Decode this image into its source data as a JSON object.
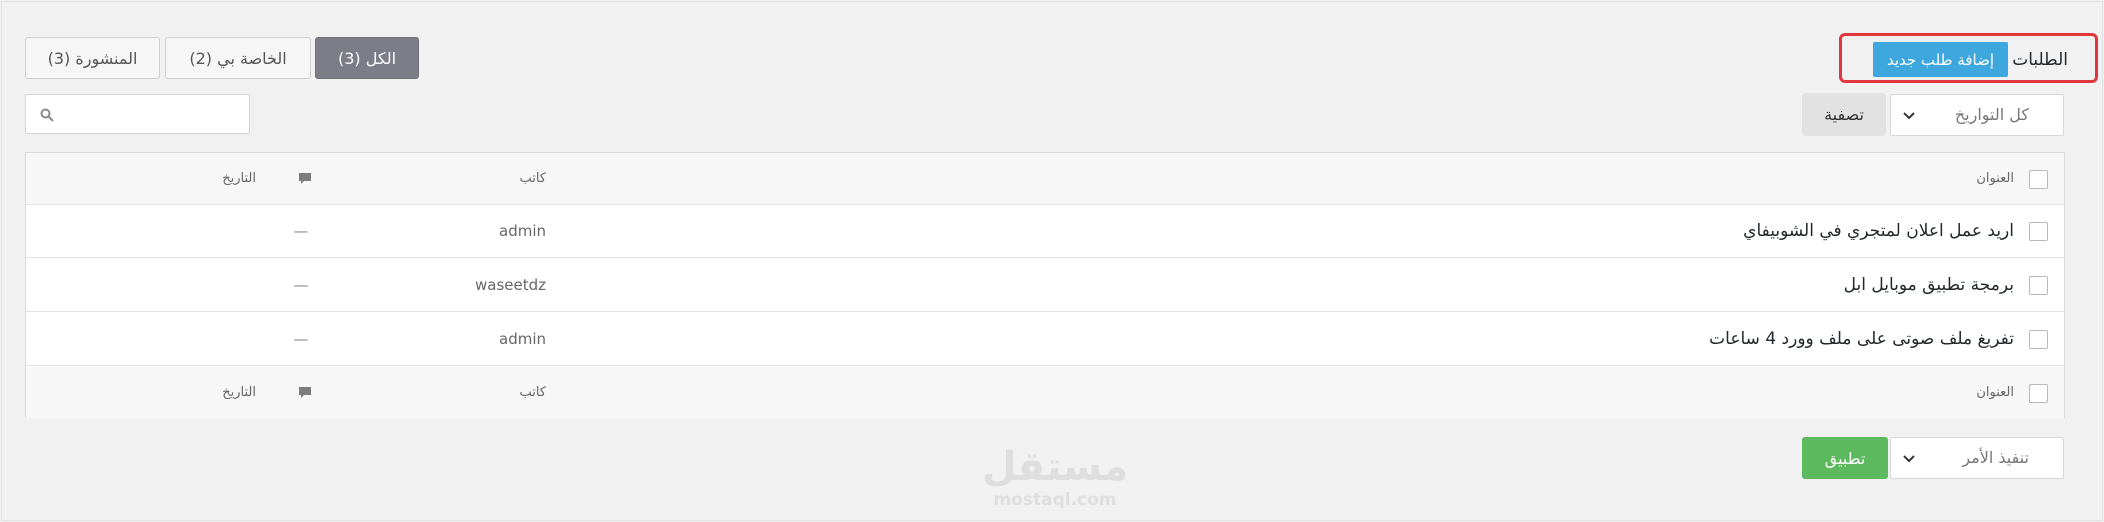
{
  "header": {
    "title": "الطلبات",
    "add_button_label": "إضافة طلب جديد"
  },
  "tabs": [
    {
      "label": "الكل (3)",
      "active": true
    },
    {
      "label": "الخاصة بي (2)",
      "active": false
    },
    {
      "label": "المنشورة (3)",
      "active": false
    }
  ],
  "filters": {
    "date_select_value": "كل التواريخ",
    "filter_button_label": "تصفية",
    "search_placeholder": ""
  },
  "table": {
    "columns": {
      "title": "العنوان",
      "author": "كاتب",
      "date": "التاريخ"
    },
    "rows": [
      {
        "title": "اريد عمل اعلان لمتجري في الشوبيفاي",
        "author": "admin",
        "comments": "—",
        "date": ""
      },
      {
        "title": "برمجة تطبيق موبايل ابل",
        "author": "waseetdz",
        "comments": "—",
        "date": ""
      },
      {
        "title": "تفريغ ملف صوتى على ملف وورد 4 ساعات",
        "author": "admin",
        "comments": "—",
        "date": ""
      }
    ]
  },
  "bulk_actions": {
    "select_value": "تنفيذ الأمر",
    "apply_button_label": "تطبيق"
  },
  "watermark": {
    "logo_text": "مستقل",
    "url": "mostaql.com"
  },
  "colors": {
    "primary_blue": "#3ea7dd",
    "apply_green": "#5db95d",
    "highlight_red": "#e2363f",
    "active_tab": "#7c7d86"
  }
}
